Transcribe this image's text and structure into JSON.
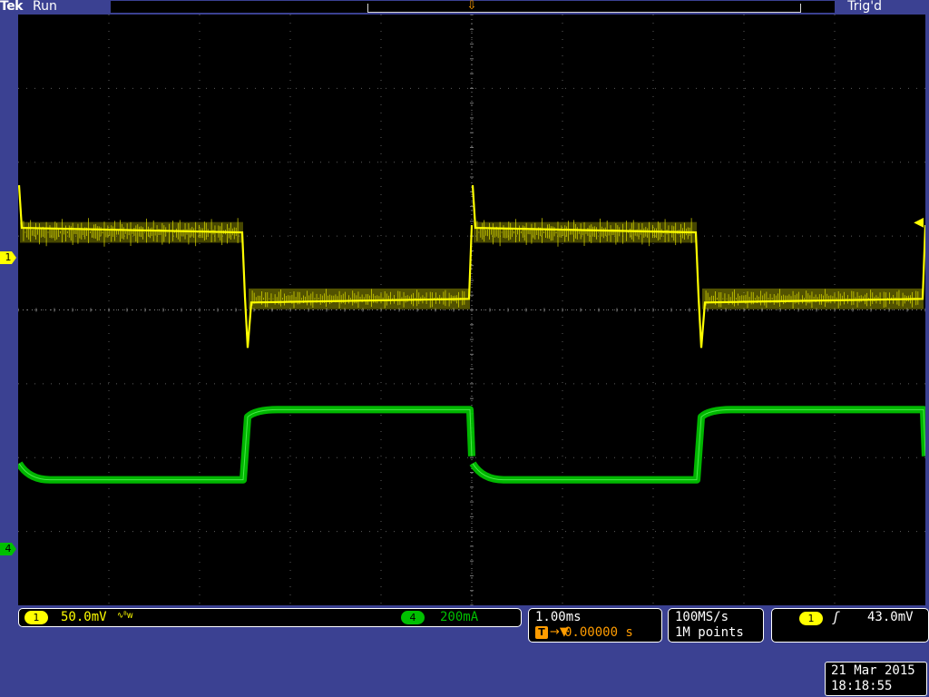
{
  "top_status": {
    "brand": "Tek",
    "state": "Run",
    "trigger_status": "Trig'd",
    "trigger_position_icon": "trigger-position-marker",
    "trigger_t_label": "T"
  },
  "channels": {
    "ch1": {
      "label": "1",
      "scale": "50.0mV",
      "coupling": "∿ᴮw",
      "color": "#ffff00"
    },
    "ch4": {
      "label": "4",
      "scale": "200mA",
      "color": "#00c000"
    }
  },
  "timebase": {
    "scale": "1.00ms",
    "delay_label": "T",
    "delay_arrows": "→▼",
    "delay": "0.00000 s"
  },
  "acquisition": {
    "sample_rate": "100MS/s",
    "record_length": "1M points"
  },
  "trigger": {
    "source": "1",
    "slope_icon": "rising-edge-icon",
    "slope_glyph": "ʃ",
    "level": "43.0mV"
  },
  "datetime": {
    "date": "21 Mar 2015",
    "time": "18:18:55"
  },
  "chart_data": {
    "type": "line",
    "x_divisions": 10,
    "y_divisions": 8,
    "x_unit_per_div": "1.00ms",
    "grid": true,
    "series": [
      {
        "name": "1",
        "color": "#ffff00",
        "scale": "50.0mV/div",
        "periods": 2,
        "high_level_divisions": 1.05,
        "low_level_divisions": 0.15,
        "noise_band_divisions": 0.28
      },
      {
        "name": "4",
        "color": "#00c000",
        "scale": "200mA/div",
        "periods": 2,
        "high_level_divisions": -1.35,
        "low_level_divisions": -2.3,
        "noise_band_divisions": 0.1
      }
    ]
  }
}
